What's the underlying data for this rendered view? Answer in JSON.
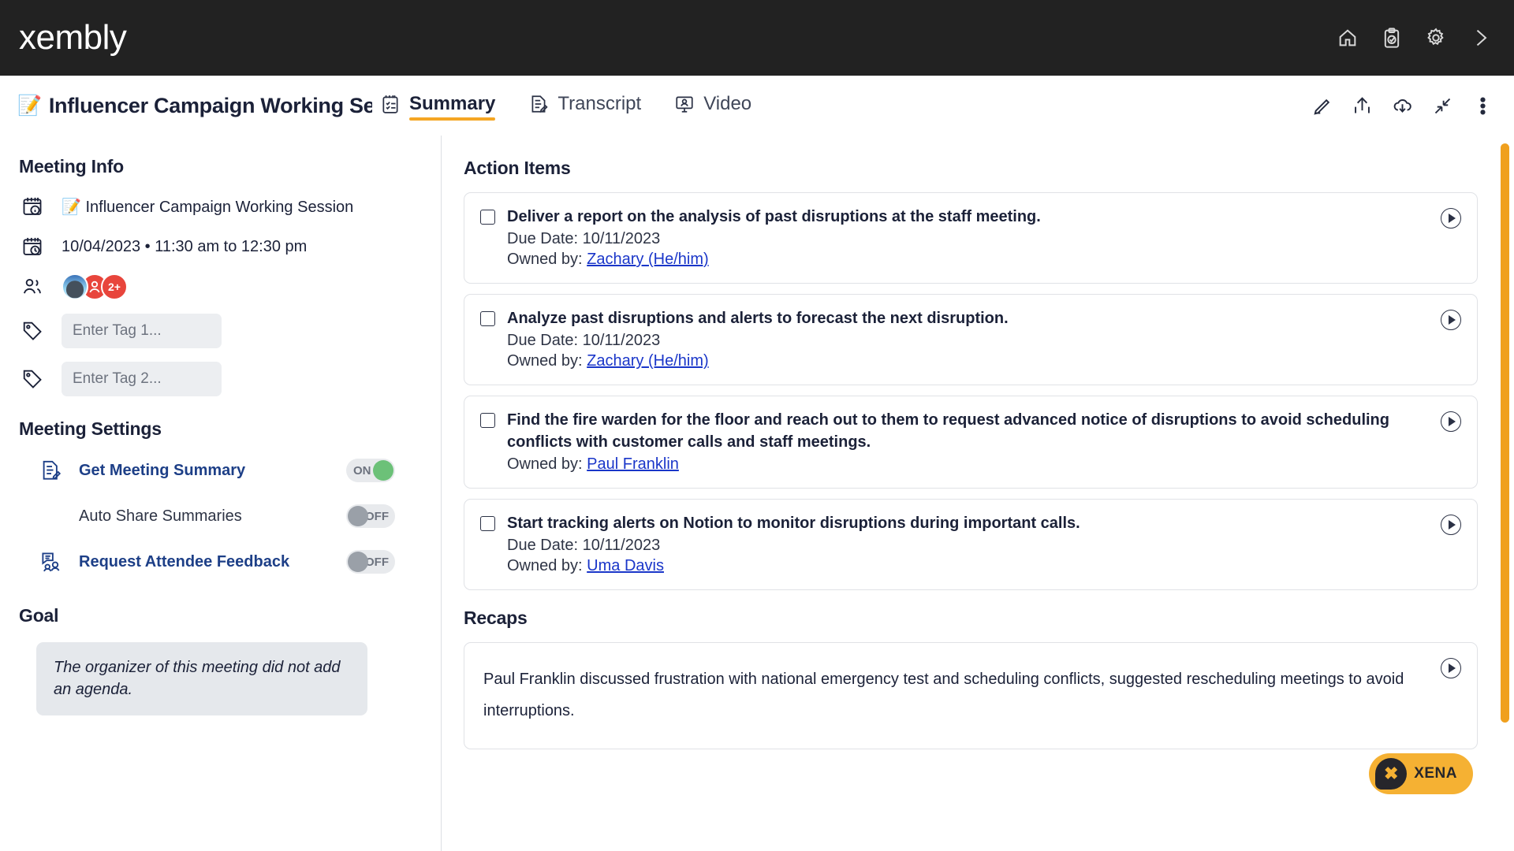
{
  "brand": {
    "logo": "xembly",
    "accent": "#f5a623",
    "orange": "#f0a01e",
    "dark": "#222222"
  },
  "topbar": {
    "icons": [
      {
        "name": "home-icon",
        "label": "Home"
      },
      {
        "name": "tasks-clipboard-icon",
        "label": "Tasks"
      },
      {
        "name": "settings-gear-icon",
        "label": "Settings"
      },
      {
        "name": "chevron-right-icon",
        "label": "Expand"
      }
    ]
  },
  "meetbar": {
    "emoji": "📝",
    "title": "Influencer Campaign Working Se...",
    "tabs": [
      {
        "label": "Summary",
        "icon": "summary-checklist-icon",
        "active": true
      },
      {
        "label": "Transcript",
        "icon": "transcript-document-icon",
        "active": false
      },
      {
        "label": "Video",
        "icon": "video-monitor-icon",
        "active": false
      }
    ],
    "actions": [
      {
        "name": "edit-pencil-icon",
        "label": "Edit"
      },
      {
        "name": "share-upload-icon",
        "label": "Share"
      },
      {
        "name": "cloud-download-icon",
        "label": "Download"
      },
      {
        "name": "collapse-arrows-icon",
        "label": "Collapse"
      },
      {
        "name": "more-options-icon",
        "label": "More"
      }
    ]
  },
  "sidebar": {
    "meeting_info_title": "Meeting Info",
    "meeting_name": "📝 Influencer Campaign Working Session",
    "meeting_datetime": "10/04/2023 • 11:30 am to 12:30 pm",
    "attendees_overflow": "2+",
    "tag1_placeholder": "Enter Tag 1...",
    "tag1_value": "",
    "tag2_placeholder": "Enter Tag 2...",
    "tag2_value": "",
    "settings_title": "Meeting Settings",
    "settings": [
      {
        "label": "Get Meeting Summary",
        "state": "ON",
        "on": true,
        "icon": "summary-doc-pencil-icon",
        "sub": false
      },
      {
        "label": "Auto Share Summaries",
        "state": "OFF",
        "on": false,
        "icon": "",
        "sub": true
      },
      {
        "label": "Request Attendee Feedback",
        "state": "OFF",
        "on": false,
        "icon": "attendee-feedback-icon",
        "sub": false
      }
    ],
    "goal_title": "Goal",
    "goal_text": "The organizer of this meeting did not add an agenda."
  },
  "main": {
    "action_items_title": "Action Items",
    "action_items": [
      {
        "title": "Deliver a report on the analysis of past disruptions at the staff meeting.",
        "due_label": "Due Date: 10/11/2023",
        "owner_label": "Owned by:",
        "owner": "Zachary (He/him)",
        "checked": false
      },
      {
        "title": "Analyze past disruptions and alerts to forecast the next disruption.",
        "due_label": "Due Date: 10/11/2023",
        "owner_label": "Owned by:",
        "owner": "Zachary (He/him)",
        "checked": false
      },
      {
        "title": "Find the fire warden for the floor and reach out to them to request advanced notice of disruptions to avoid scheduling conflicts with customer calls and staff meetings.",
        "due_label": "",
        "owner_label": "Owned by:",
        "owner": "Paul Franklin",
        "checked": false
      },
      {
        "title": "Start tracking alerts on Notion to monitor disruptions during important calls.",
        "due_label": "Due Date: 10/11/2023",
        "owner_label": "Owned by:",
        "owner": "Uma Davis",
        "checked": false
      }
    ],
    "recaps_title": "Recaps",
    "recap_text": "Paul Franklin  discussed frustration with national emergency test and scheduling conflicts, suggested rescheduling meetings to avoid interruptions."
  },
  "xena": {
    "label": "XENA"
  }
}
